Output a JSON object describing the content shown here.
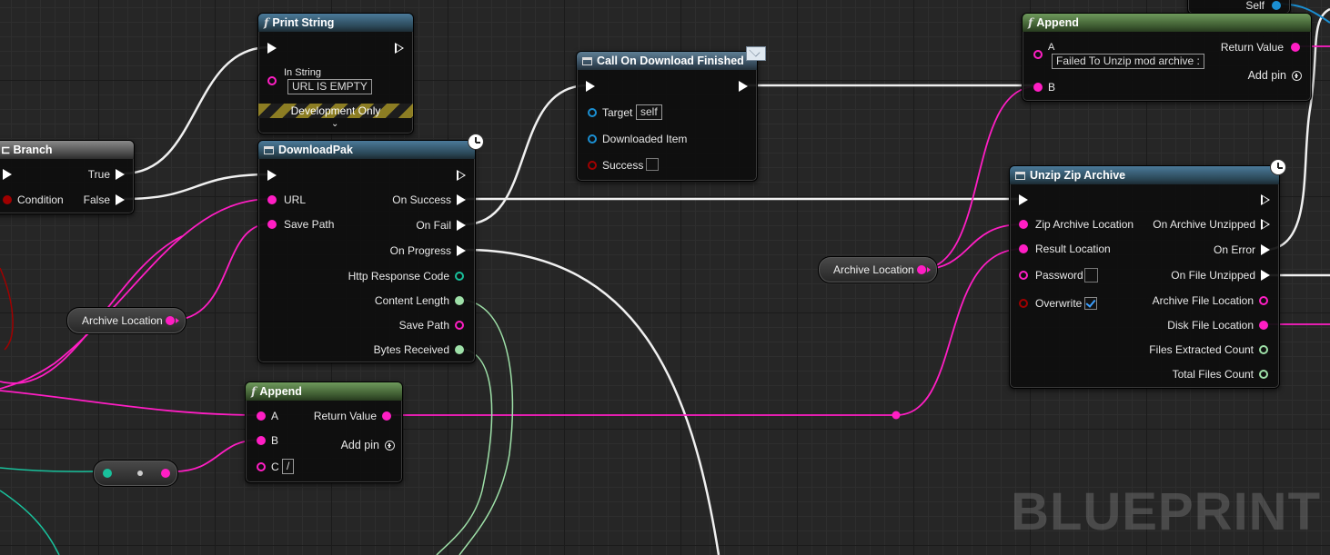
{
  "watermark": "BLUEPRINT",
  "colors": {
    "exec": "#ffffff",
    "string": "#ff1ec4",
    "object": "#1b8fd2",
    "bool": "#a00000",
    "int": "#9ee0a8",
    "teal": "#19c19c"
  },
  "print_string": {
    "title": "Print String",
    "in_string_label": "In String",
    "in_string_value": "URL IS EMPTY",
    "dev_label": "Development Only"
  },
  "branch": {
    "title": "Branch",
    "true_label": "True",
    "false_label": "False",
    "condition_label": "Condition"
  },
  "download_pak": {
    "title": "DownloadPak",
    "url": "URL",
    "save_path": "Save Path",
    "on_success": "On Success",
    "on_fail": "On Fail",
    "on_progress": "On Progress",
    "http_code": "Http Response Code",
    "content_length": "Content Length",
    "save_path_out": "Save Path",
    "bytes_received": "Bytes Received"
  },
  "call_download": {
    "title": "Call On Download Finished",
    "target_label": "Target",
    "target_value": "self",
    "downloaded_item": "Downloaded Item",
    "success": "Success"
  },
  "append_top": {
    "title": "Append",
    "a_label": "A",
    "a_value": "Failed To Unzip mod archive :",
    "b_label": "B",
    "return_value": "Return Value",
    "add_pin": "Add pin"
  },
  "self_node": {
    "label": "Self"
  },
  "unzip": {
    "title": "Unzip Zip Archive",
    "zip_loc": "Zip Archive Location",
    "result_loc": "Result Location",
    "password": "Password",
    "overwrite": "Overwrite",
    "overwrite_checked": true,
    "on_archive_unzipped": "On Archive Unzipped",
    "on_error": "On Error",
    "on_file_unzipped": "On File Unzipped",
    "archive_file_loc": "Archive File Location",
    "disk_file_loc": "Disk File Location",
    "files_extracted": "Files Extracted Count",
    "total_files": "Total Files Count"
  },
  "archive_var_right": {
    "label": "Archive Location"
  },
  "archive_var_left": {
    "label": "Archive Location"
  },
  "append_bottom": {
    "title": "Append",
    "a_label": "A",
    "b_label": "B",
    "c_label": "C",
    "c_value": "/",
    "return_value": "Return Value",
    "add_pin": "Add pin"
  }
}
